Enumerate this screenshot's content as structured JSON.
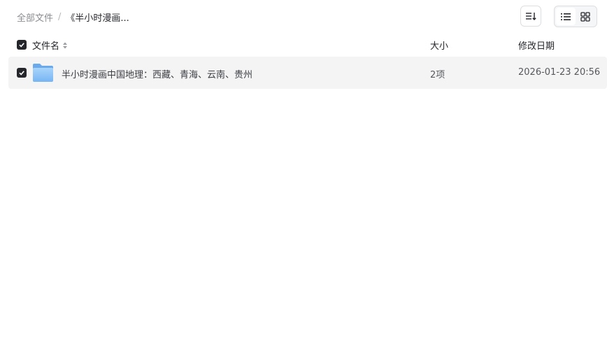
{
  "breadcrumb": {
    "root": "全部文件",
    "separator": "/",
    "current": "《半小时漫画..."
  },
  "toolbar": {
    "sort_icon": "sort-lines-icon",
    "list_icon": "list-view-icon",
    "grid_icon": "grid-view-icon",
    "active_view": "list"
  },
  "table": {
    "columns": {
      "name": "文件名",
      "size": "大小",
      "modified": "修改日期"
    },
    "select_all_checked": true,
    "rows": [
      {
        "icon": "folder-icon",
        "name": "半小时漫画中国地理：西藏、青海、云南、贵州",
        "size": "2项",
        "modified": "2026-01-23 20:56",
        "checked": true
      }
    ]
  },
  "colors": {
    "accent_dark": "#25262b",
    "row_highlight": "#f4f4f5",
    "folder_blue": "#8cc2f7"
  }
}
